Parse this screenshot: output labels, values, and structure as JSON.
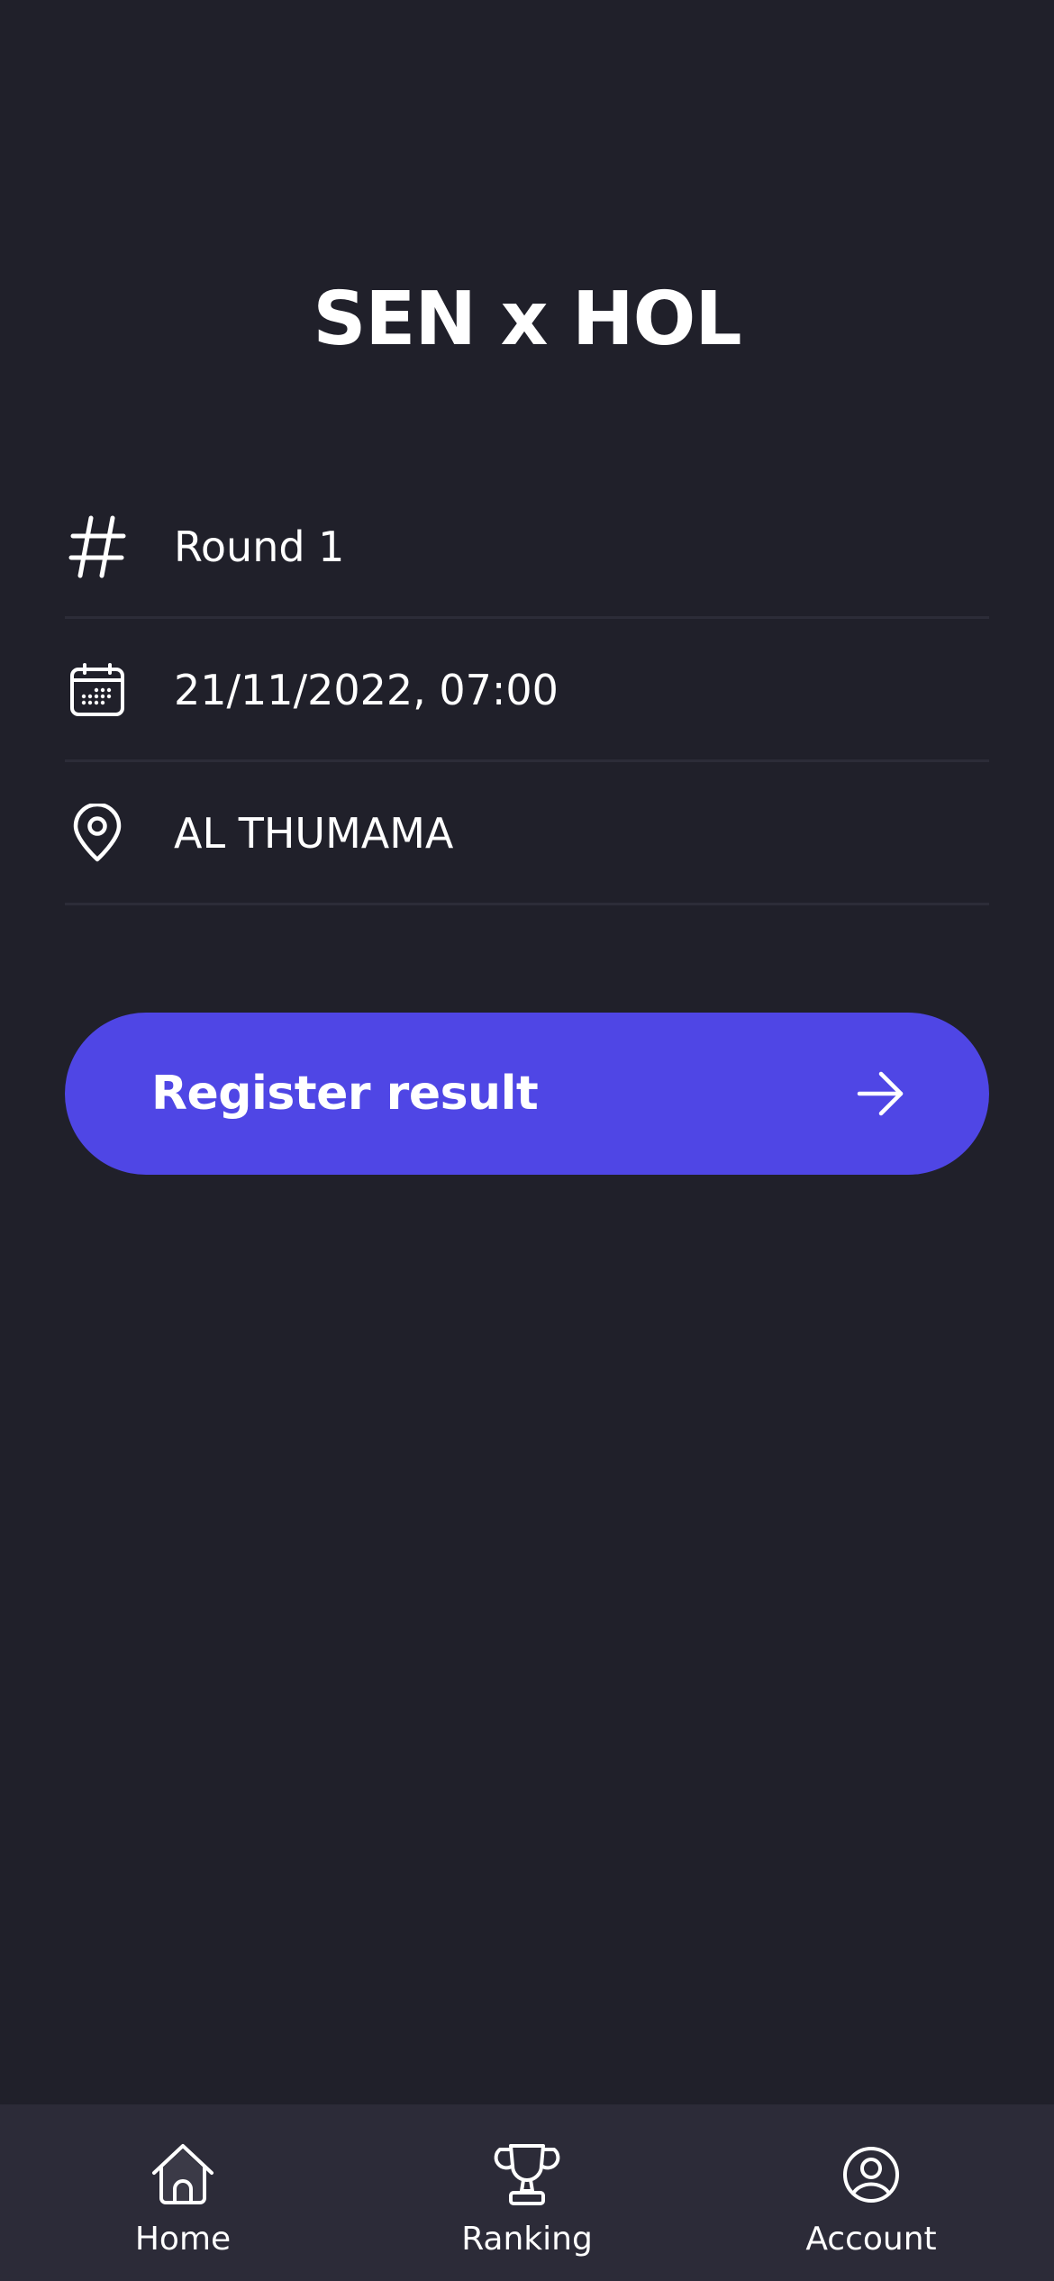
{
  "match": {
    "title": "SEN x HOL"
  },
  "details": {
    "round": {
      "icon": "hash-icon",
      "value": "Round 1"
    },
    "date": {
      "icon": "calendar-icon",
      "value": "21/11/2022, 07:00"
    },
    "venue": {
      "icon": "location-pin-icon",
      "value": "AL THUMAMA"
    }
  },
  "actions": {
    "register_label": "Register result",
    "register_icon": "arrow-right-icon"
  },
  "nav": {
    "items": [
      {
        "label": "Home",
        "icon": "home-icon",
        "active": true
      },
      {
        "label": "Ranking",
        "icon": "trophy-icon",
        "active": false
      },
      {
        "label": "Account",
        "icon": "account-icon",
        "active": false
      }
    ]
  },
  "colors": {
    "background": "#20202a",
    "nav_background": "#2c2b38",
    "accent": "#4f46e5",
    "divider": "#2c2c38",
    "text": "#ffffff"
  }
}
